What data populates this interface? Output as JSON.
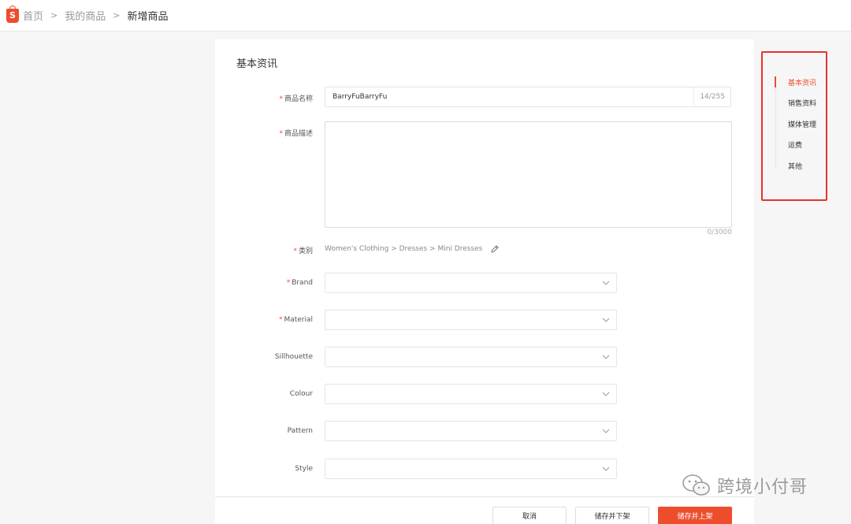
{
  "breadcrumb": {
    "logo": "S",
    "home": "首页",
    "my_products": "我的商品",
    "current": "新增商品",
    "separator": ">"
  },
  "form": {
    "section_title": "基本资讯",
    "required_mark": "*",
    "name": {
      "label": "商品名称",
      "value": "BarryFuBarryFu",
      "counter": "14/255"
    },
    "description": {
      "label": "商品描述",
      "value": "",
      "counter": "0/3000"
    },
    "category": {
      "label": "类别",
      "path": "Women's Clothing > Dresses > Mini Dresses"
    },
    "attributes": [
      {
        "label": "Brand",
        "required": true,
        "value": ""
      },
      {
        "label": "Material",
        "required": true,
        "value": ""
      },
      {
        "label": "Sillhouette",
        "required": false,
        "value": ""
      },
      {
        "label": "Colour",
        "required": false,
        "value": ""
      },
      {
        "label": "Pattern",
        "required": false,
        "value": ""
      },
      {
        "label": "Style",
        "required": false,
        "value": ""
      }
    ]
  },
  "footer": {
    "cancel": "取消",
    "save_unlist": "储存并下架",
    "save_publish": "储存并上架"
  },
  "right_nav": {
    "items": [
      "基本资讯",
      "销售资料",
      "媒体管理",
      "运费",
      "其他"
    ],
    "active_index": 0
  },
  "watermark": {
    "text": "跨境小付哥"
  },
  "colors": {
    "brand": "#ee4d2d",
    "highlight_box": "#e8312d"
  }
}
